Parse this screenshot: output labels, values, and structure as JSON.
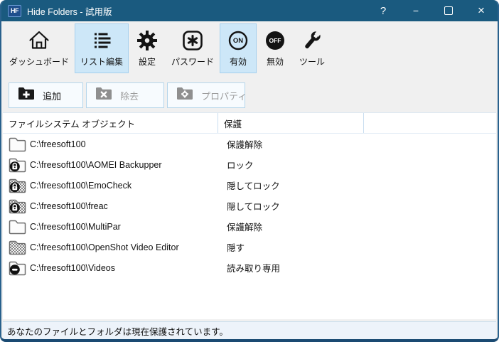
{
  "window": {
    "title": "Hide Folders - 試用版",
    "app_icon_text": "HF",
    "controls": {
      "help": "?",
      "minimize": "−",
      "close": "×"
    }
  },
  "toolbar": {
    "items": [
      {
        "label": "ダッシュボード",
        "icon": "home-icon",
        "selected": false
      },
      {
        "label": "リスト編集",
        "icon": "list-edit-icon",
        "selected": true
      },
      {
        "label": "設定",
        "icon": "gear-icon",
        "selected": false
      },
      {
        "label": "パスワード",
        "icon": "password-icon",
        "selected": false
      },
      {
        "label": "有効",
        "icon": "on-icon",
        "selected": true
      },
      {
        "label": "無効",
        "icon": "off-icon",
        "selected": false
      },
      {
        "label": "ツール",
        "icon": "wrench-icon",
        "selected": false
      }
    ]
  },
  "actions": {
    "add": {
      "label": "追加",
      "enabled": true
    },
    "remove": {
      "label": "除去",
      "enabled": false
    },
    "properties": {
      "label": "プロパティ",
      "enabled": false
    }
  },
  "table": {
    "columns": [
      "ファイルシステム オブジェクト",
      "保護"
    ],
    "rows": [
      {
        "path": "C:\\freesoft100",
        "protection": "保護解除",
        "icon": "folder-plain"
      },
      {
        "path": "C:\\freesoft100\\AOMEI Backupper",
        "protection": "ロック",
        "icon": "folder-lock"
      },
      {
        "path": "C:\\freesoft100\\EmoCheck",
        "protection": "隠してロック",
        "icon": "folder-hidden-lock"
      },
      {
        "path": "C:\\freesoft100\\freac",
        "protection": "隠してロック",
        "icon": "folder-hidden-lock"
      },
      {
        "path": "C:\\freesoft100\\MultiPar",
        "protection": "保護解除",
        "icon": "folder-plain"
      },
      {
        "path": "C:\\freesoft100\\OpenShot Video Editor",
        "protection": "隠す",
        "icon": "folder-hidden"
      },
      {
        "path": "C:\\freesoft100\\Videos",
        "protection": "読み取り専用",
        "icon": "folder-readonly"
      }
    ]
  },
  "statusbar": {
    "message": "あなたのファイルとフォルダは現在保護されています。"
  },
  "colors": {
    "titlebar": "#1a5a7f",
    "toolbar_bg": "#f0f0f0",
    "selected_bg": "#cde7f8",
    "selected_border": "#a5d0ee",
    "button_border": "#b5d5ea",
    "column_line": "#c9def0",
    "statusbar_bg": "#edf3fa",
    "window_border": "#29618d"
  }
}
